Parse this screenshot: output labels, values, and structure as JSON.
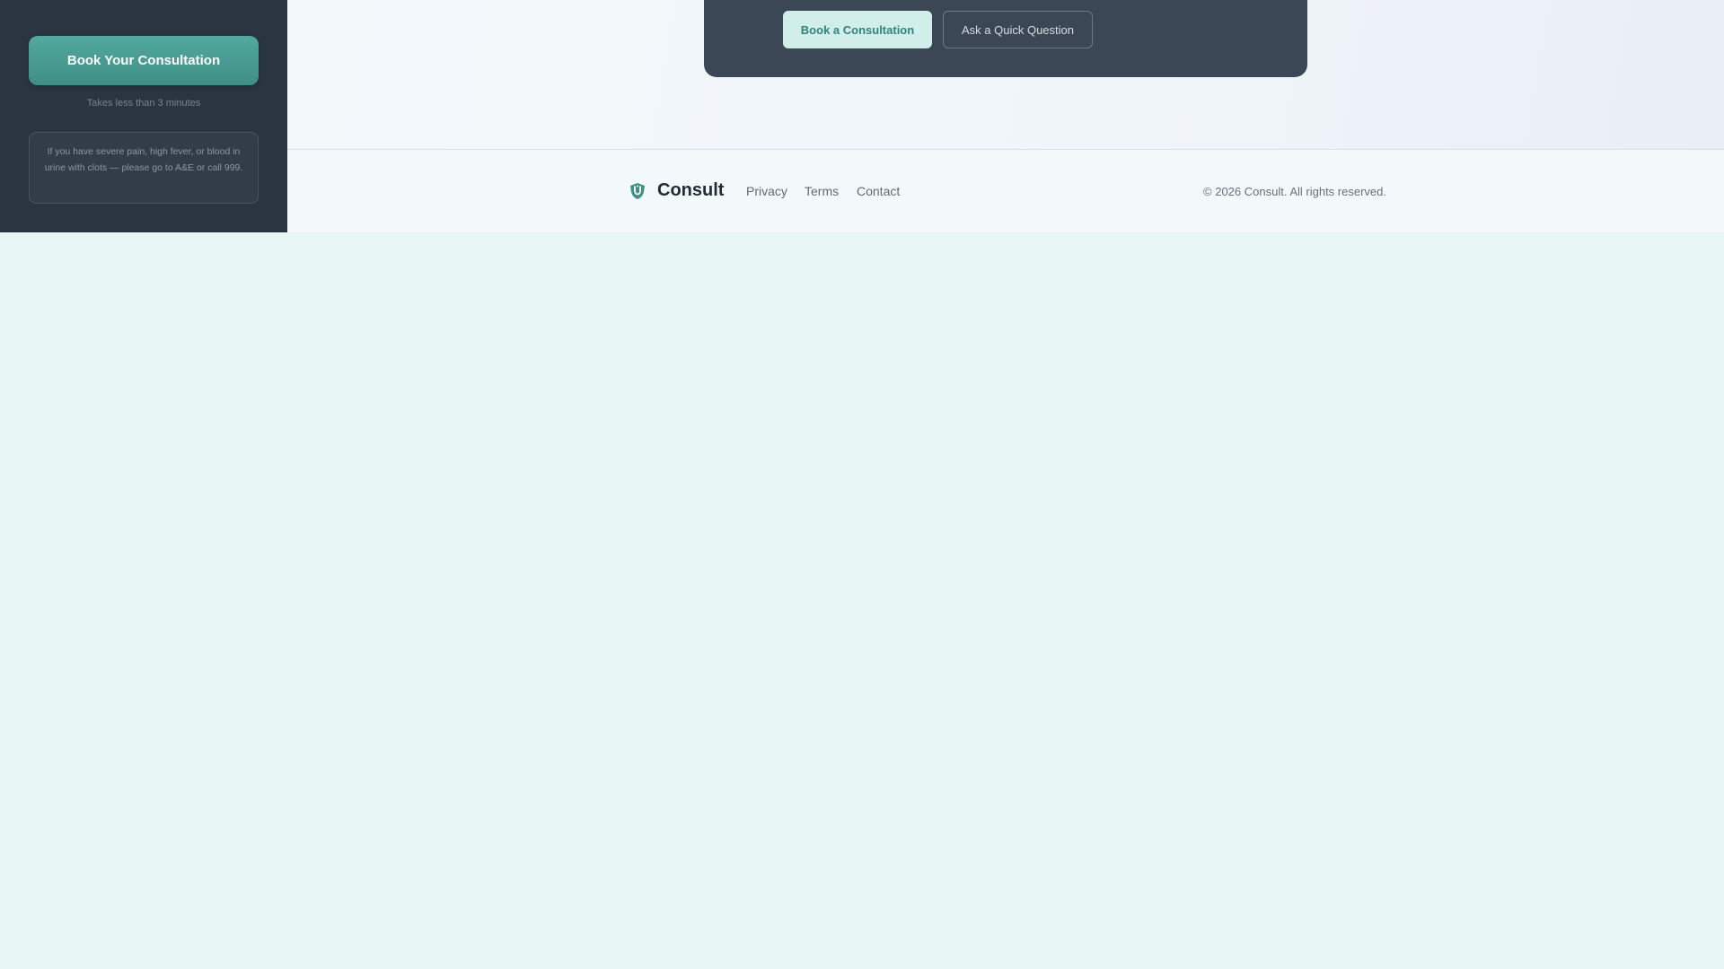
{
  "sidebar": {
    "cta_label": "Book Your Consultation",
    "note": "Takes less than 3 minutes",
    "warning": "If you have severe pain, high fever, or blood in urine with clots — please go to A&E or call 999."
  },
  "hero": {
    "primary_button": "Book a Consultation",
    "secondary_button": "Ask a Quick Question"
  },
  "footer": {
    "brand_name": "Consult",
    "logo_icon": "shield-icon",
    "links": [
      "Privacy",
      "Terms",
      "Contact"
    ],
    "copyright": "© 2026 Consult. All rights reserved."
  },
  "colors": {
    "sidebar_bg": "#2a3541",
    "accent": "#4a9e94",
    "page_bg": "#e8f7f6",
    "hero_bg": "#3b4754"
  }
}
